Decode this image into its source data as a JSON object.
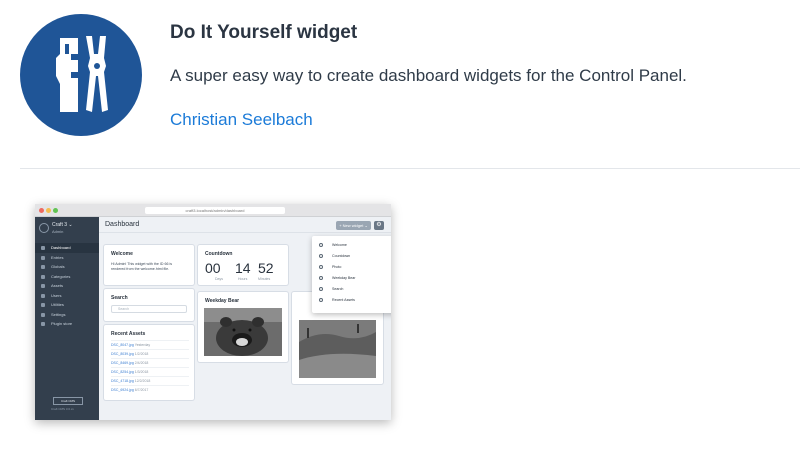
{
  "plugin": {
    "title": "Do It Yourself widget",
    "description": "A super easy way to create dashboard widgets for the Control Panel.",
    "author": "Christian Seelbach",
    "brand_color": "#1f5597",
    "link_color": "#1c7bd8"
  },
  "screenshot": {
    "url": "craft3.localhost/admin/dashboard",
    "sidebar": {
      "site_name": "Craft 3 ⌄",
      "site_user": "Admin",
      "items": [
        {
          "label": "Dashboard",
          "active": true
        },
        {
          "label": "Entries"
        },
        {
          "label": "Globals"
        },
        {
          "label": "Categories"
        },
        {
          "label": "Assets"
        },
        {
          "label": "Users"
        },
        {
          "label": "Utilities"
        },
        {
          "label": "Settings"
        },
        {
          "label": "Plugin store"
        }
      ],
      "badge": "Craft CMS",
      "badge_sub": "Craft CMS 3.0.xx"
    },
    "topbar": {
      "title": "Dashboard",
      "new_widget": "+ New widget ⌄",
      "gear": "⚙"
    },
    "welcome": {
      "heading": "Welcome",
      "line1": "Hi Admin! This widget with the ID 66 is",
      "line2": "rendered from the welcome.html file."
    },
    "search": {
      "heading": "Search",
      "placeholder": "Search"
    },
    "recent_assets": {
      "heading": "Recent Assets",
      "items": [
        {
          "name": "DSC_8047.jpg",
          "date": "Yesterday"
        },
        {
          "name": "DSC_8039.jpg",
          "date": "1/2/2018"
        },
        {
          "name": "DSC_8469.jpg",
          "date": "2/4/2018"
        },
        {
          "name": "DSC_8254.jpg",
          "date": "1/3/2018"
        },
        {
          "name": "DSC_4718.jpg",
          "date": "12/2/2018"
        },
        {
          "name": "DSC_6924.jpg",
          "date": "6/7/2017"
        }
      ]
    },
    "countdown": {
      "heading": "Countdown",
      "days": "00",
      "hours": "14",
      "minutes": "52",
      "days_label": "Days",
      "hours_label": "Hours",
      "minutes_label": "Minutes"
    },
    "weekday_bear": {
      "heading": "Weekday Bear"
    },
    "popup_items": [
      {
        "label": "Welcome"
      },
      {
        "label": "Countdown"
      },
      {
        "label": "Photo"
      },
      {
        "label": "Weekday Bear"
      },
      {
        "label": "Search"
      },
      {
        "label": "Recent Assets"
      }
    ]
  }
}
